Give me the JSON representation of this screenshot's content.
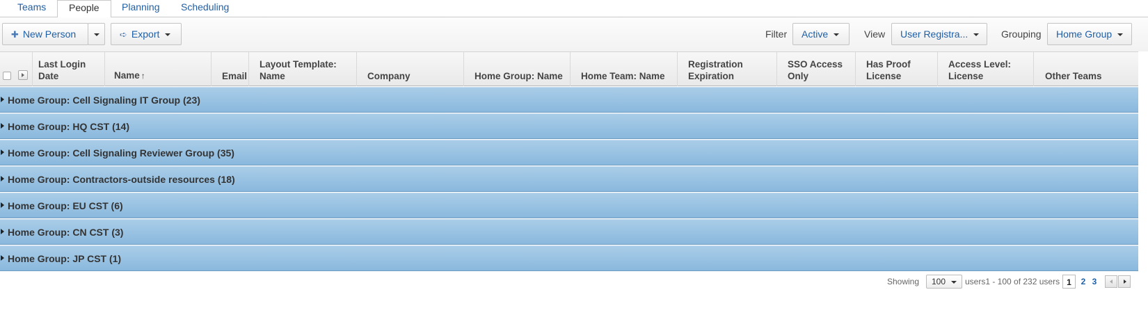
{
  "tabs": [
    "Teams",
    "People",
    "Planning",
    "Scheduling"
  ],
  "active_tab": "People",
  "toolbar": {
    "new_person": "New Person",
    "export": "Export",
    "filter_label": "Filter",
    "filter_value": "Active",
    "view_label": "View",
    "view_value": "User Registra...",
    "grouping_label": "Grouping",
    "grouping_value": "Home Group"
  },
  "columns": {
    "last_login": [
      "Last Login",
      "Date"
    ],
    "name": "Name",
    "name_sort_glyph": "↑",
    "email": "Email",
    "layout_template": [
      "Layout Template:",
      "Name"
    ],
    "company": "Company",
    "home_group_name": "Home Group: Name",
    "home_team_name": "Home Team: Name",
    "registration_expiration": [
      "Registration",
      "Expiration"
    ],
    "sso_access_only": [
      "SSO Access",
      "Only"
    ],
    "has_proof_license": [
      "Has Proof",
      "License"
    ],
    "access_level_license": [
      "Access Level:",
      "License"
    ],
    "other_teams": "Other Teams"
  },
  "groups": [
    "Home Group: Cell Signaling IT Group (23)",
    "Home Group: HQ CST (14)",
    "Home Group: Cell Signaling Reviewer Group (35)",
    "Home Group: Contractors-outside resources (18)",
    "Home Group: EU CST (6)",
    "Home Group: CN CST (3)",
    "Home Group: JP CST (1)"
  ],
  "footer": {
    "showing_label": "Showing",
    "page_size": "100",
    "range_text": "users1 - 100 of 232 users",
    "pages": [
      "1",
      "2",
      "3"
    ],
    "current_page": "1"
  },
  "colors": {
    "link": "#1f5fa6",
    "group_row_top": "#a9cde8",
    "group_row_bottom": "#8ab8dd"
  },
  "icons": {
    "new_person": "plus-icon",
    "export": "arrow-right-icon"
  }
}
